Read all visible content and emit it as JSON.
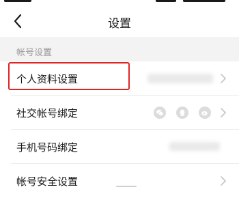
{
  "header": {
    "title": "设置",
    "back_icon": "chevron-left-icon"
  },
  "section": {
    "label": "帐号设置"
  },
  "rows": [
    {
      "label": "个人资料设置",
      "icon": "chevron-right-icon"
    },
    {
      "label": "社交帐号绑定",
      "icon": "chevron-right-icon",
      "bindings": [
        "wechat-icon",
        "qq-icon",
        "weibo-icon"
      ]
    },
    {
      "label": "手机号码绑定"
    },
    {
      "label": "帐号安全设置",
      "icon": "chevron-right-icon"
    }
  ],
  "colors": {
    "highlight": "#e02424",
    "section_bg": "#f3f3f3",
    "muted": "#9b9b9b"
  }
}
